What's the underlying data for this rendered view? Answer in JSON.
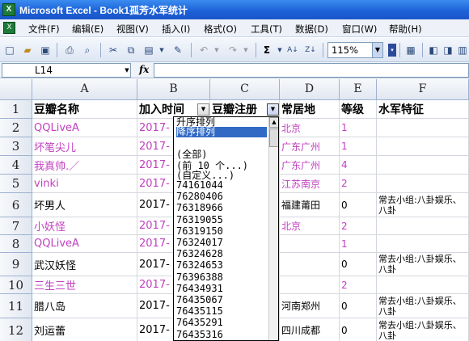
{
  "window": {
    "title": "Microsoft Excel - Book1孤芳水军统计"
  },
  "menu": [
    "文件(F)",
    "编辑(E)",
    "视图(V)",
    "插入(I)",
    "格式(O)",
    "工具(T)",
    "数据(D)",
    "窗口(W)",
    "帮助(H)"
  ],
  "toolbar": {
    "zoom": "115%"
  },
  "formula_bar": {
    "name_box": "L14",
    "fx": "fx",
    "content": ""
  },
  "columns": [
    "A",
    "B",
    "C",
    "D",
    "E",
    "F"
  ],
  "rows": [
    "1",
    "2",
    "3",
    "4",
    "5",
    "6",
    "7",
    "8",
    "9",
    "10",
    "11",
    "12"
  ],
  "headers": {
    "a": "豆瓣名称",
    "b": "加入时间",
    "c": "豆瓣注册",
    "d": "常居地",
    "e": "等级",
    "f": "水军特征"
  },
  "table": [
    {
      "a": "QQLiveA",
      "b": "2017-",
      "d": "北京",
      "e": "1",
      "f": "",
      "pink": true
    },
    {
      "a": "坏笔尖儿",
      "b": "2017-",
      "d": "广东广州",
      "e": "1",
      "f": "",
      "pink": true
    },
    {
      "a": "我真帅.／",
      "b": "2017-",
      "d": "广东广州",
      "e": "4",
      "f": "",
      "pink": true
    },
    {
      "a": "vinki",
      "b": "2017-",
      "d": "江苏南京",
      "e": "2",
      "f": "",
      "pink": true
    },
    {
      "a": "坏男人",
      "b": "2017-",
      "d": "福建莆田",
      "e": "0",
      "f": "常去小组:八卦娱乐、八卦",
      "pink": false
    },
    {
      "a": "小妖怪",
      "b": "2017-",
      "d": "北京",
      "e": "2",
      "f": "",
      "pink": true
    },
    {
      "a": "QQLiveA",
      "b": "2017-",
      "d": "",
      "e": "1",
      "f": "",
      "pink": true
    },
    {
      "a": "武汉妖怪",
      "b": "2017-",
      "d": "",
      "e": "0",
      "f": "常去小组:八卦娱乐、八卦",
      "pink": false
    },
    {
      "a": "三生三世",
      "b": "2017-",
      "d": "",
      "e": "2",
      "f": "",
      "pink": true
    },
    {
      "a": "腊八岛",
      "b": "2017-",
      "d": "河南郑州",
      "e": "0",
      "f": "常去小组:八卦娱乐、八卦",
      "pink": false
    },
    {
      "a": "刘运蕾",
      "b": "2017-",
      "d": "四川成都",
      "e": "0",
      "f": "常去小组:八卦娱乐、八卦",
      "pink": false
    }
  ],
  "filter_dropdown": {
    "selected": "降序排列",
    "items": [
      "升序排列",
      "降序排列",
      "",
      "(全部)",
      "(前 10 个...)",
      "(自定义...)",
      "74161044",
      "76280406",
      "76318966",
      "76319055",
      "76319150",
      "76324017",
      "76324628",
      "76324653",
      "76396388",
      "76434931",
      "76435067",
      "76435115",
      "76435291",
      "76435316"
    ]
  }
}
